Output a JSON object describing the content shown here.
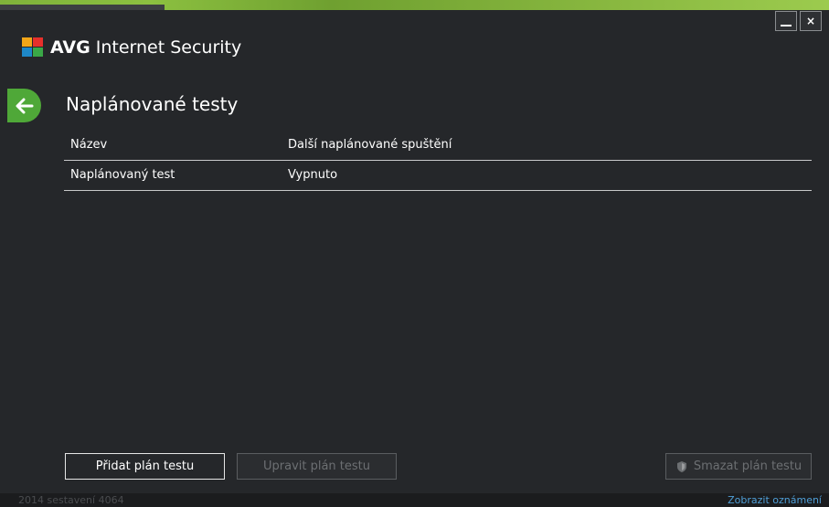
{
  "app": {
    "brand": "AVG",
    "product": "Internet Security"
  },
  "window_controls": {
    "minimize_icon": "minimize-icon",
    "close_label": "×"
  },
  "page": {
    "title": "Naplánované testy"
  },
  "table": {
    "columns": [
      "Název",
      "Další naplánované spuštění"
    ],
    "rows": [
      {
        "name": "Naplánovaný test",
        "next_run": "Vypnuto"
      }
    ]
  },
  "buttons": {
    "add": "Přidat plán testu",
    "edit": "Upravit plán testu",
    "delete": "Smazat plán testu"
  },
  "status": {
    "build": "2014  sestavení 4064",
    "notifications_link": "Zobrazit oznámení"
  },
  "colors": {
    "accent_green": "#4fa838",
    "background": "#25272a",
    "link": "#4f9fd8"
  }
}
